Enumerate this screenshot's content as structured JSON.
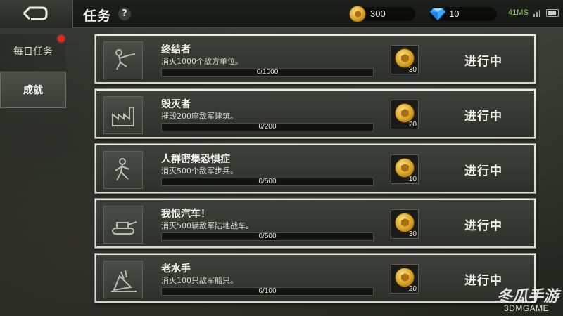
{
  "header": {
    "title": "任务",
    "help": "?",
    "gold": "300",
    "gems": "10",
    "ping": "41MS"
  },
  "sidebar": {
    "tabs": [
      {
        "label": "每日任务",
        "has_badge": true,
        "selected": false
      },
      {
        "label": "成就",
        "has_badge": false,
        "selected": true
      }
    ]
  },
  "missions": [
    {
      "icon": "soldier-icon",
      "name": "终结者",
      "desc": "消灭1000个敌方单位。",
      "progress_text": "0/1000",
      "progress": 0,
      "reward": "30",
      "status": "进行中"
    },
    {
      "icon": "factory-icon",
      "name": "毁灭者",
      "desc": "摧毁200座敌军建筑。",
      "progress_text": "0/200",
      "progress": 0,
      "reward": "20",
      "status": "进行中"
    },
    {
      "icon": "infantry-icon",
      "name": "人群密集恐惧症",
      "desc": "消灭500个敌军步兵。",
      "progress_text": "0/500",
      "progress": 0,
      "reward": "10",
      "status": "进行中"
    },
    {
      "icon": "tank-icon",
      "name": "我恨汽车！",
      "desc": "消灭500辆敌军陆地战车。",
      "progress_text": "0/500",
      "progress": 0,
      "reward": "30",
      "status": "进行中"
    },
    {
      "icon": "sinking-ship-icon",
      "name": "老水手",
      "desc": "消灭100只敌军船只。",
      "progress_text": "0/100",
      "progress": 0,
      "reward": "20",
      "status": "进行中"
    }
  ],
  "watermark": {
    "main": "冬瓜手游",
    "sub": "3DMGAME"
  },
  "colors": {
    "progress_fill": "#8bbf3a",
    "badge_red": "#e02a1c",
    "ping_green": "#8fd14f"
  }
}
